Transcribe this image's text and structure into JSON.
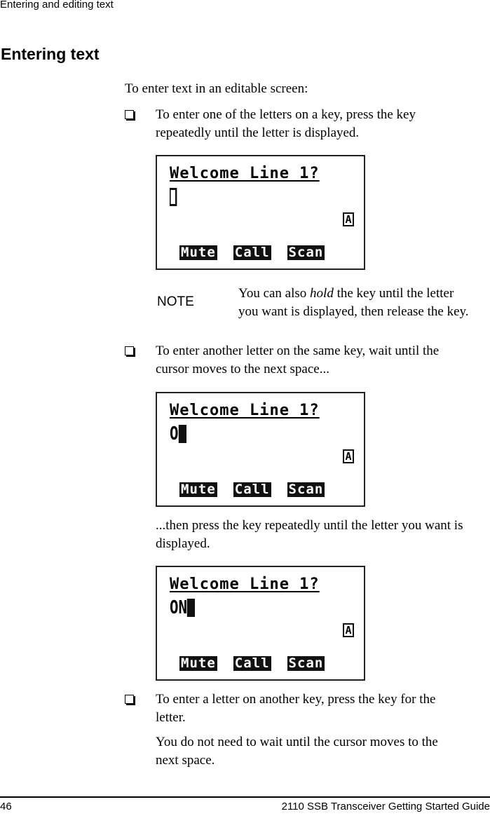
{
  "header": {
    "running_title": "Entering and editing text"
  },
  "section": {
    "title": "Entering text",
    "intro": "To enter text in an editable screen:"
  },
  "bullets": [
    {
      "lines": [
        "To enter one of the letters on a key, press the key",
        "repeatedly until the letter is displayed."
      ]
    },
    {
      "lines": [
        "To enter another letter on the same key, wait until the",
        "cursor moves to the next space..."
      ]
    },
    {
      "lines": [
        "To enter a letter on another key, press the key for the",
        "letter."
      ]
    }
  ],
  "note": {
    "label": "NOTE",
    "line1_pre": "You can also ",
    "line1_em": "hold",
    "line1_post": " the key until the letter",
    "line2": "you want is displayed, then release the key."
  },
  "then_para": {
    "lines": [
      "...then press the key repeatedly until the letter you want is",
      "displayed."
    ]
  },
  "final_para": {
    "lines": [
      "You do not need to wait until the cursor moves to the",
      "next space."
    ]
  },
  "screens": [
    {
      "title": "Welcome Line 1?",
      "entry_text": "",
      "cursor": "outline-block",
      "mode": "A",
      "softkeys": [
        "Mute",
        "Call",
        "Scan"
      ]
    },
    {
      "title": "Welcome Line 1?",
      "entry_text": "O",
      "cursor": "solid-block",
      "mode": "A",
      "softkeys": [
        "Mute",
        "Call",
        "Scan"
      ]
    },
    {
      "title": "Welcome Line 1?",
      "entry_text": "ON",
      "cursor": "solid-block",
      "mode": "A",
      "softkeys": [
        "Mute",
        "Call",
        "Scan"
      ]
    }
  ],
  "footer": {
    "page_number": "46",
    "guide_title": "2110 SSB Transceiver Getting Started Guide"
  }
}
